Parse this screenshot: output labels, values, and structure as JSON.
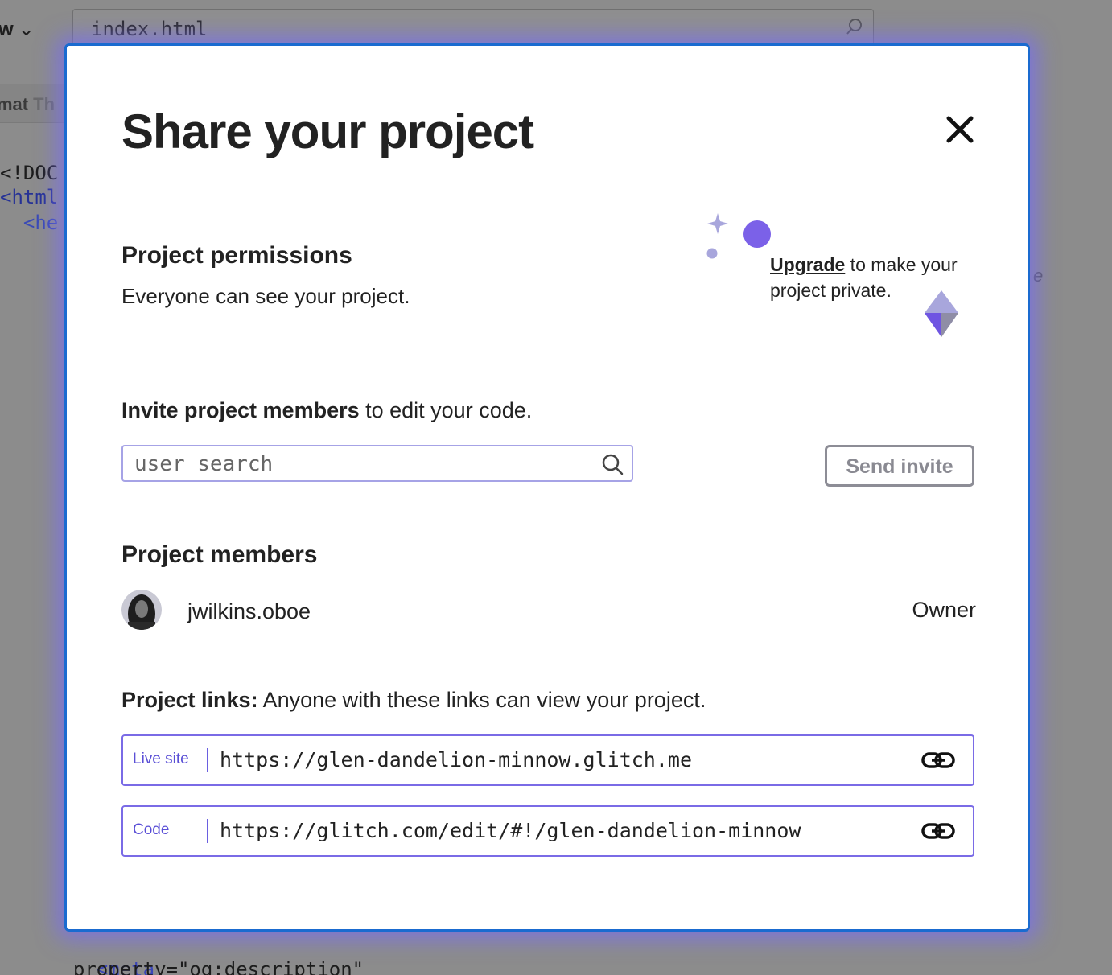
{
  "background": {
    "view_menu_label": "w",
    "filename": "index.html",
    "format_label": "mat",
    "format_suffix": "Th",
    "code_lines": [
      "<!DOC",
      "<html",
      "  <he"
    ],
    "bottom_tag": "<meta",
    "bottom_attr": "  property=\"og:description\"",
    "right_fragment": "e"
  },
  "modal": {
    "title": "Share your project",
    "permissions": {
      "heading": "Project permissions",
      "text": "Everyone can see your project.",
      "upgrade_link": "Upgrade",
      "upgrade_text": " to make your project private."
    },
    "invite": {
      "bold": "Invite project members",
      "rest": " to edit your code.",
      "search_placeholder": "user search",
      "send_button": "Send invite"
    },
    "members": {
      "heading": "Project members",
      "list": [
        {
          "name": "jwilkins.oboe",
          "role": "Owner"
        }
      ]
    },
    "links": {
      "bold": "Project links:",
      "rest": " Anyone with these links can view your project.",
      "items": [
        {
          "label": "Live site",
          "url": "https://glen-dandelion-minnow.glitch.me"
        },
        {
          "label": "Code",
          "url": "https://glitch.com/edit/#!/glen-dandelion-minnow"
        }
      ]
    }
  },
  "colors": {
    "accent_purple": "#7a6be6",
    "focus_blue": "#1a6bd0",
    "button_gray": "#8d8d96"
  }
}
